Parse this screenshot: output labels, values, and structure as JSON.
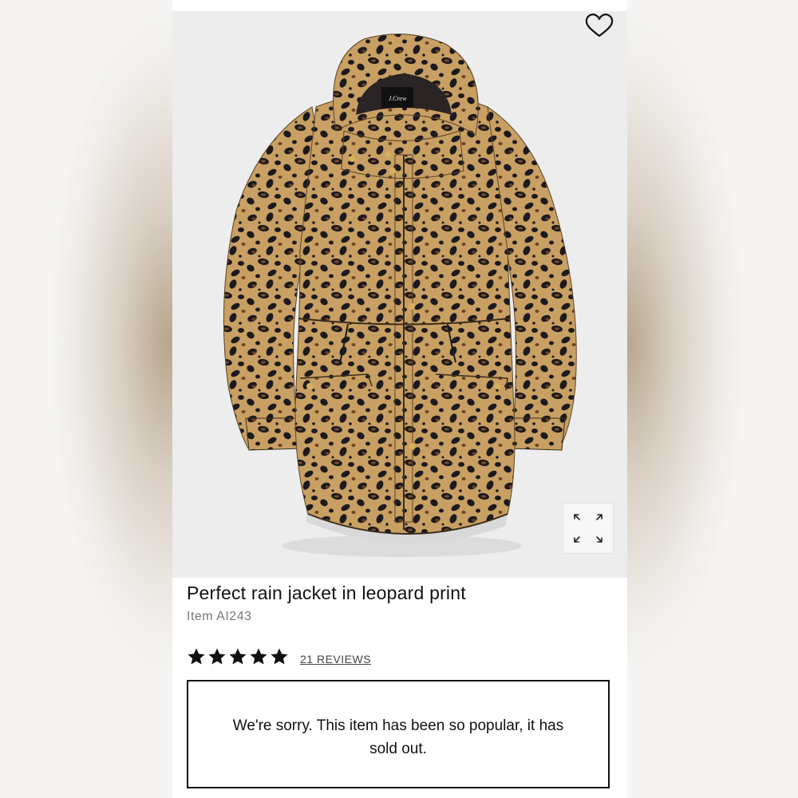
{
  "product": {
    "title": "Perfect rain jacket in leopard print",
    "item_number": "Item AI243",
    "rating": 5,
    "rating_max": 5,
    "reviews_label": "21 REVIEWS",
    "image_icon": "jacket-illustration",
    "brand_label": "J.Crew"
  },
  "actions": {
    "favorite_icon": "heart-icon",
    "expand_icon": "expand-arrows-icon"
  },
  "notice": {
    "sold_out_message": "We're sorry. This item has been so popular, it has sold out."
  },
  "colors": {
    "jacket_base": "#c9a063",
    "spot_dark": "#1c1a1f",
    "spot_brown": "#6e4223",
    "image_bg": "#ededed"
  }
}
